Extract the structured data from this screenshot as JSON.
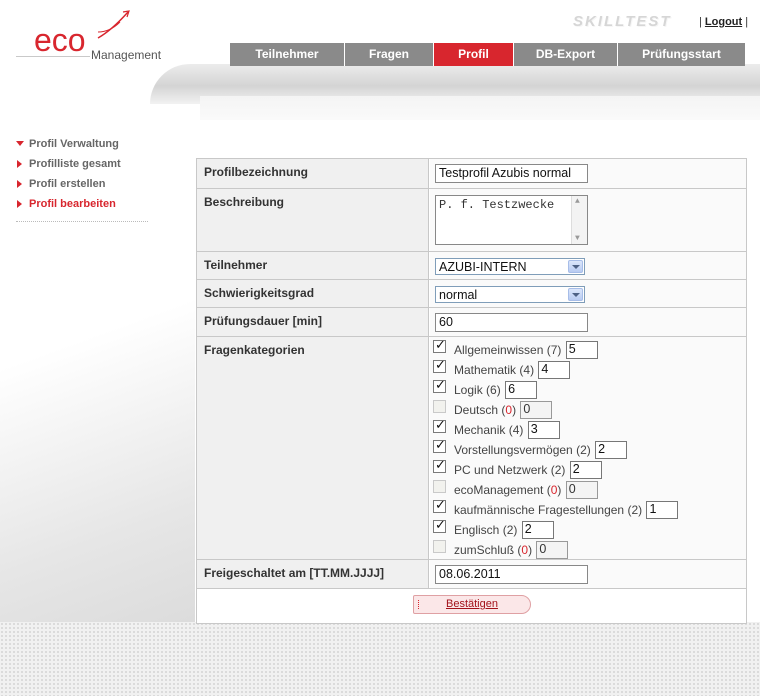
{
  "logo": {
    "brand": "eco",
    "sub": "Management"
  },
  "header": {
    "product": "SKILLTEST",
    "sep_left": "|",
    "logout": "Logout",
    "sep_right": "|"
  },
  "tabs": [
    {
      "label": "Teilnehmer",
      "active": false
    },
    {
      "label": "Fragen",
      "active": false
    },
    {
      "label": "Profil",
      "active": true
    },
    {
      "label": "DB-Export",
      "active": false
    },
    {
      "label": "Prüfungsstart",
      "active": false
    }
  ],
  "menu": [
    {
      "label": "Profil Verwaltung"
    },
    {
      "label": "Profilliste gesamt"
    },
    {
      "label": "Profil erstellen"
    },
    {
      "label": "Profil bearbeiten"
    }
  ],
  "form": {
    "name_label": "Profilbezeichnung",
    "name_value": "Testprofil Azubis normal",
    "desc_label": "Beschreibung",
    "desc_value": "P. f. Testzwecke",
    "participants_label": "Teilnehmer",
    "participants_value": "AZUBI-INTERN",
    "difficulty_label": "Schwierigkeitsgrad",
    "difficulty_value": "normal",
    "duration_label": "Prüfungsdauer [min]",
    "duration_value": "60",
    "categories_label": "Fragenkategorien",
    "categories": [
      {
        "name": "Allgemeinwissen",
        "count": "7",
        "value": "5",
        "checked": true
      },
      {
        "name": "Mathematik",
        "count": "4",
        "value": "4",
        "checked": true
      },
      {
        "name": "Logik",
        "count": "6",
        "value": "6",
        "checked": true
      },
      {
        "name": "Deutsch",
        "count": "0",
        "value": "0",
        "checked": false
      },
      {
        "name": "Mechanik",
        "count": "4",
        "value": "3",
        "checked": true
      },
      {
        "name": "Vorstellungsvermögen",
        "count": "2",
        "value": "2",
        "checked": true
      },
      {
        "name": "PC und Netzwerk",
        "count": "2",
        "value": "2",
        "checked": true
      },
      {
        "name": "ecoManagement",
        "count": "0",
        "value": "0",
        "checked": false
      },
      {
        "name": "kaufmännische Fragestellungen",
        "count": "2",
        "value": "1",
        "checked": true
      },
      {
        "name": "Englisch",
        "count": "2",
        "value": "2",
        "checked": true
      },
      {
        "name": "zumSchluß",
        "count": "0",
        "value": "0",
        "checked": false
      }
    ],
    "enabled_label": "Freigeschaltet am [TT.MM.JJJJ]",
    "enabled_value": "08.06.2011",
    "submit_label": "Bestätigen"
  },
  "colors": {
    "accent": "#d8262e",
    "tab": "#8a8a8a"
  }
}
